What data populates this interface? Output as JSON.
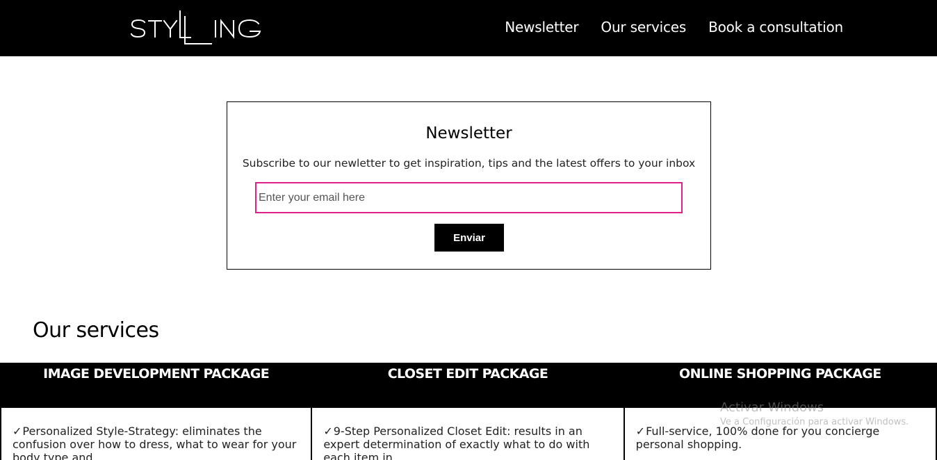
{
  "header": {
    "logo_text": "STYLLING",
    "nav": [
      {
        "label": "Newsletter"
      },
      {
        "label": "Our services"
      },
      {
        "label": "Book a consultation"
      }
    ]
  },
  "newsletter": {
    "title": "Newsletter",
    "subtitle": "Subscribe to our newletter to get inspiration, tips and the latest offers to your inbox",
    "email_placeholder": "Enter your email here",
    "email_value": "",
    "submit_label": "Enviar"
  },
  "services": {
    "title": "Our services",
    "packages": [
      {
        "name": "IMAGE DEVELOPMENT PACKAGE",
        "feature": "Personalized Style-Strategy: eliminates the confusion over how to dress, what to wear for your body type and"
      },
      {
        "name": "CLOSET EDIT PACKAGE",
        "feature": "9-Step Personalized Closet Edit: results in an expert determination of exactly what to do with each item in"
      },
      {
        "name": "ONLINE SHOPPING PACKAGE",
        "feature": "Full-service, 100% done for you concierge personal shopping."
      }
    ]
  },
  "watermark": {
    "title": "Activar Windows",
    "subtitle": "Ve a Configuración para activar Windows."
  },
  "colors": {
    "header_bg": "#000000",
    "input_border": "#e0208a",
    "button_bg": "#000000"
  }
}
